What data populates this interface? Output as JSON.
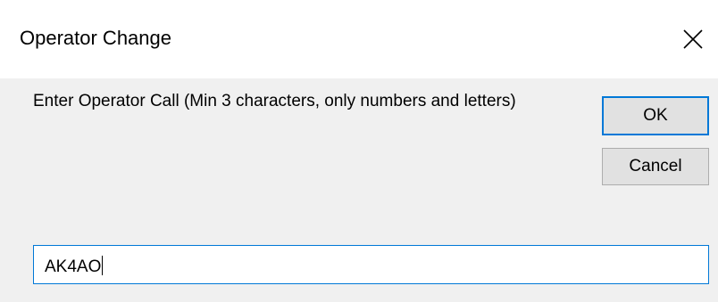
{
  "window": {
    "title": "Operator Change",
    "close_icon": "close-icon"
  },
  "dialog": {
    "prompt": "Enter Operator Call (Min 3 characters, only numbers and letters)",
    "ok_label": "OK",
    "cancel_label": "Cancel",
    "operator_call_value": "AK4AO"
  },
  "colors": {
    "accent": "#0078d7",
    "dialog_bg": "#f0f0f0",
    "titlebar_bg": "#ffffff",
    "button_bg": "#e1e1e1",
    "button_border": "#adadad"
  }
}
